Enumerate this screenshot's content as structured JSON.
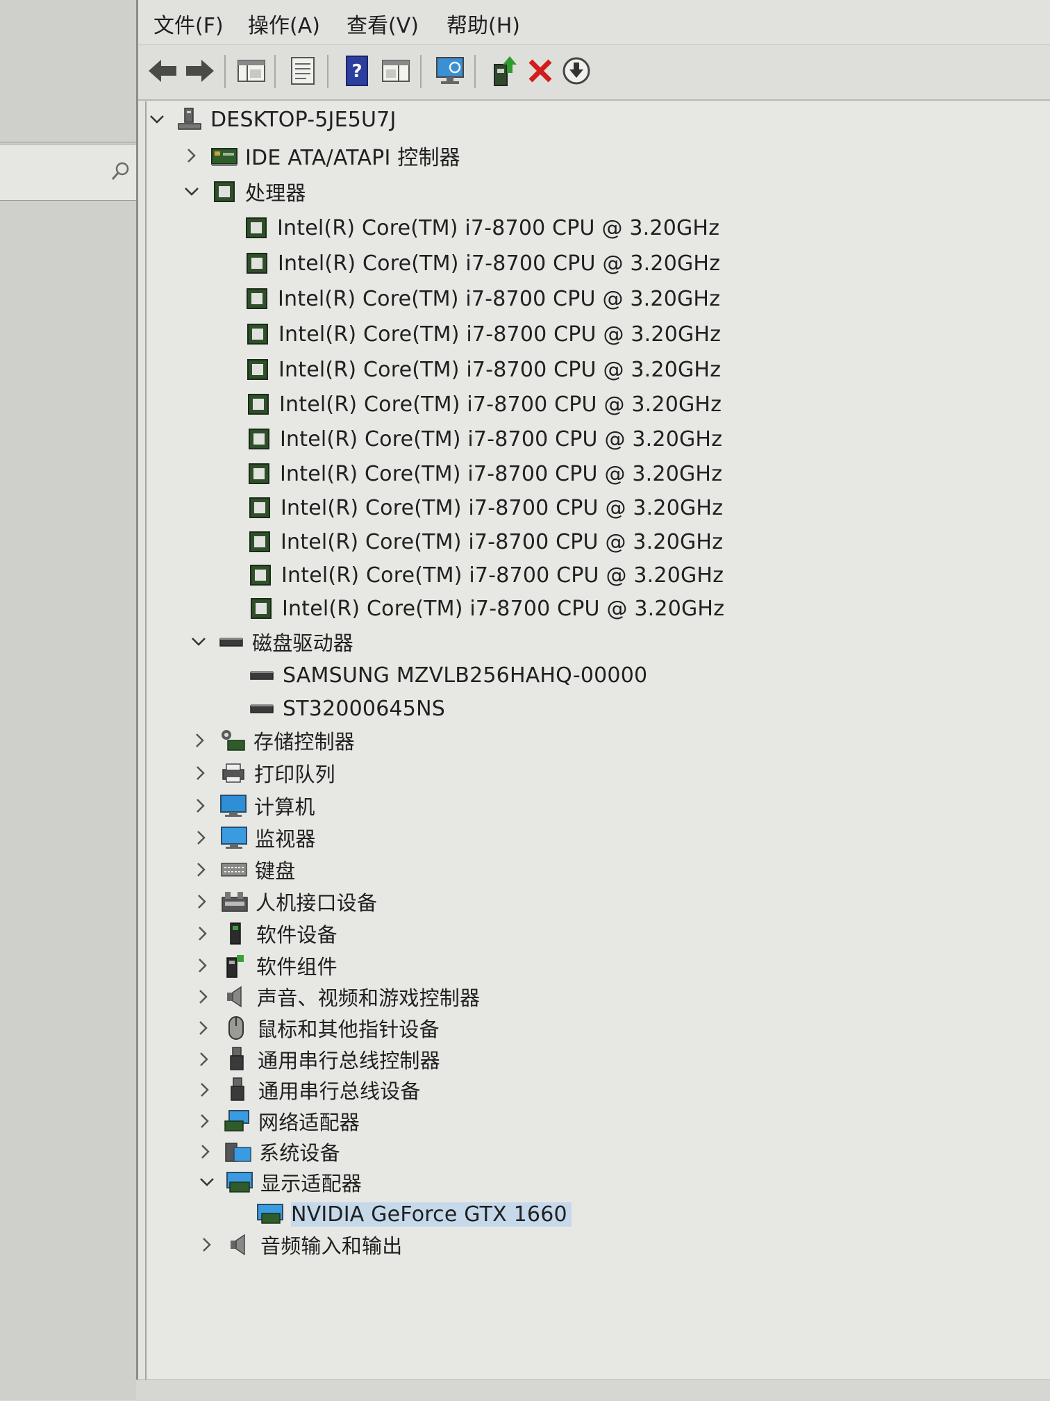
{
  "menu": [
    "文件(F)",
    "操作(A)",
    "查看(V)",
    "帮助(H)"
  ],
  "toolbar": {
    "buttons": [
      "back-arrow-icon",
      "forward-arrow-icon",
      "show-hide-tree-icon",
      "properties-icon",
      "help-icon",
      "view-icon",
      "scan-hardware-icon",
      "update-driver-icon",
      "uninstall-x-icon",
      "disable-download-icon"
    ]
  },
  "tree": {
    "root": "DESKTOP-5JE5U7J",
    "ide": "IDE ATA/ATAPI 控制器",
    "processors": {
      "label": "处理器",
      "items": [
        "Intel(R) Core(TM) i7-8700 CPU @ 3.20GHz",
        "Intel(R) Core(TM) i7-8700 CPU @ 3.20GHz",
        "Intel(R) Core(TM) i7-8700 CPU @ 3.20GHz",
        "Intel(R) Core(TM) i7-8700 CPU @ 3.20GHz",
        "Intel(R) Core(TM) i7-8700 CPU @ 3.20GHz",
        "Intel(R) Core(TM) i7-8700 CPU @ 3.20GHz",
        "Intel(R) Core(TM) i7-8700 CPU @ 3.20GHz",
        "Intel(R) Core(TM) i7-8700 CPU @ 3.20GHz",
        "Intel(R) Core(TM) i7-8700 CPU @ 3.20GHz",
        "Intel(R) Core(TM) i7-8700 CPU @ 3.20GHz",
        "Intel(R) Core(TM) i7-8700 CPU @ 3.20GHz",
        "Intel(R) Core(TM) i7-8700 CPU @ 3.20GHz"
      ]
    },
    "disks": {
      "label": "磁盘驱动器",
      "items": [
        "SAMSUNG MZVLB256HAHQ-00000",
        "ST32000645NS"
      ]
    },
    "categories": [
      "存储控制器",
      "打印队列",
      "计算机",
      "监视器",
      "键盘",
      "人机接口设备",
      "软件设备",
      "软件组件",
      "声音、视频和游戏控制器",
      "鼠标和其他指针设备",
      "通用串行总线控制器",
      "通用串行总线设备",
      "网络适配器",
      "系统设备"
    ],
    "display": {
      "label": "显示适配器",
      "items": [
        "NVIDIA GeForce GTX 1660"
      ]
    },
    "audio_io": "音频输入和输出"
  },
  "colors": {
    "selection": "#c6d9ea",
    "cpu_icon": "#2f4f2a",
    "monitor_blue": "#2f8fd6",
    "uninstall_red": "#d21d1d"
  }
}
